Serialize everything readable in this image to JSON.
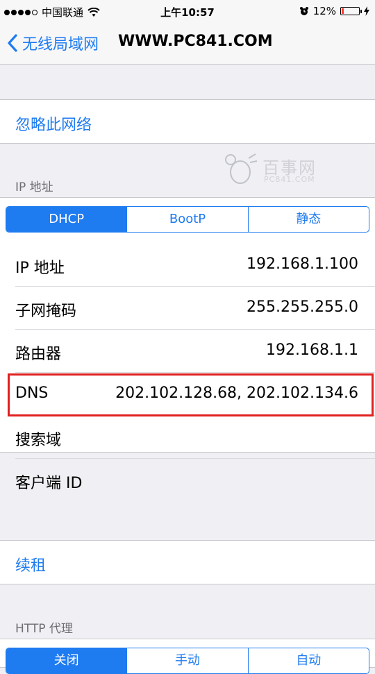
{
  "status": {
    "carrier": "中国联通",
    "time": "上午10:57",
    "battery": "12%",
    "battery_level": 0.12
  },
  "nav": {
    "back_label": "无线局域网",
    "title": "WWW.PC841.COM"
  },
  "forget_network": "忽略此网络",
  "ip_section_header": "IP 地址",
  "ip_mode_segments": [
    "DHCP",
    "BootP",
    "静态"
  ],
  "ip_rows": [
    {
      "label": "IP 地址",
      "value": "192.168.1.100"
    },
    {
      "label": "子网掩码",
      "value": "255.255.255.0"
    },
    {
      "label": "路由器",
      "value": "192.168.1.1"
    },
    {
      "label": "DNS",
      "value": "202.102.128.68, 202.102.134.6"
    },
    {
      "label": "搜索域",
      "value": ""
    },
    {
      "label": "客户端 ID",
      "value": ""
    }
  ],
  "renew_lease": "续租",
  "http_proxy_header": "HTTP 代理",
  "proxy_segments": [
    "关闭",
    "手动",
    "自动"
  ],
  "watermark": {
    "text": "百事网",
    "sub": "PC841.COM"
  },
  "colors": {
    "accent": "#1e7bf0",
    "highlight": "#e02020",
    "battery_low": "#ff3b30"
  }
}
